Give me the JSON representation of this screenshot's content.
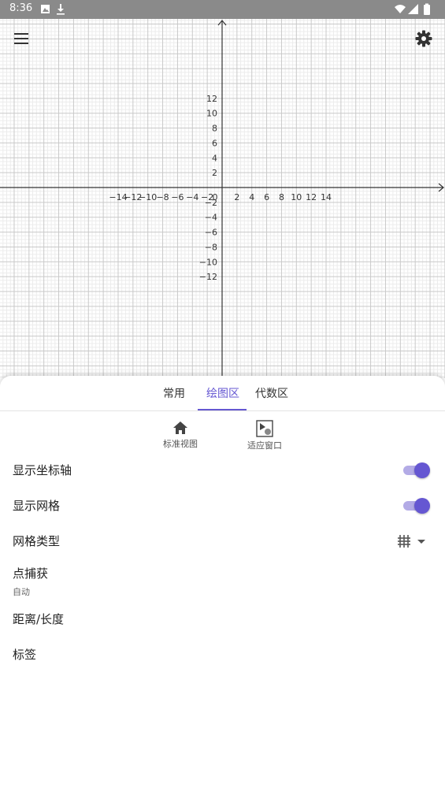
{
  "status_bar": {
    "time": "8:36",
    "left_icons": [
      "image-icon",
      "download-icon"
    ],
    "right_icons": [
      "wifi-icon",
      "signal-icon",
      "battery-icon"
    ],
    "bar_color": "#8a8a8a"
  },
  "graph": {
    "x_range": [
      -14,
      14
    ],
    "y_range": [
      -12,
      12
    ],
    "tick_step": 2,
    "x_tick_labels": [
      "−14",
      "−12",
      "−10",
      "−8",
      "−6",
      "−4",
      "−2",
      "0",
      "2",
      "4",
      "6",
      "8",
      "10",
      "12",
      "14"
    ],
    "y_tick_labels": [
      "12",
      "10",
      "8",
      "6",
      "4",
      "2",
      "−2",
      "−4",
      "−6",
      "−8",
      "−10",
      "−12"
    ],
    "show_axes": true,
    "show_grid": true,
    "major_grid_color": "#c9c9c9",
    "minor_grid_color": "#ececec",
    "axis_color": "#333333"
  },
  "toolbar": {
    "menu_icon": "menu-icon",
    "settings_icon": "gear-icon"
  },
  "tabs": [
    {
      "label": "常用",
      "active": false
    },
    {
      "label": "绘图区",
      "active": true
    },
    {
      "label": "代数区",
      "active": false
    }
  ],
  "quick_buttons": {
    "standard_view": {
      "label": "标准视图",
      "icon": "home-icon"
    },
    "fit_window": {
      "label": "适应窗口",
      "icon": "zoom-to-fit-icon"
    }
  },
  "settings": {
    "show_axes": {
      "label": "显示坐标轴",
      "value": true
    },
    "show_grid": {
      "label": "显示网格",
      "value": true
    },
    "grid_type": {
      "label": "网格类型",
      "icon": "grid-icon"
    },
    "point_capture": {
      "label": "点捕获",
      "value": "自动"
    },
    "distance": {
      "label": "距离/长度"
    },
    "labels": {
      "label": "标签"
    }
  },
  "accent_color": "#6557d2"
}
